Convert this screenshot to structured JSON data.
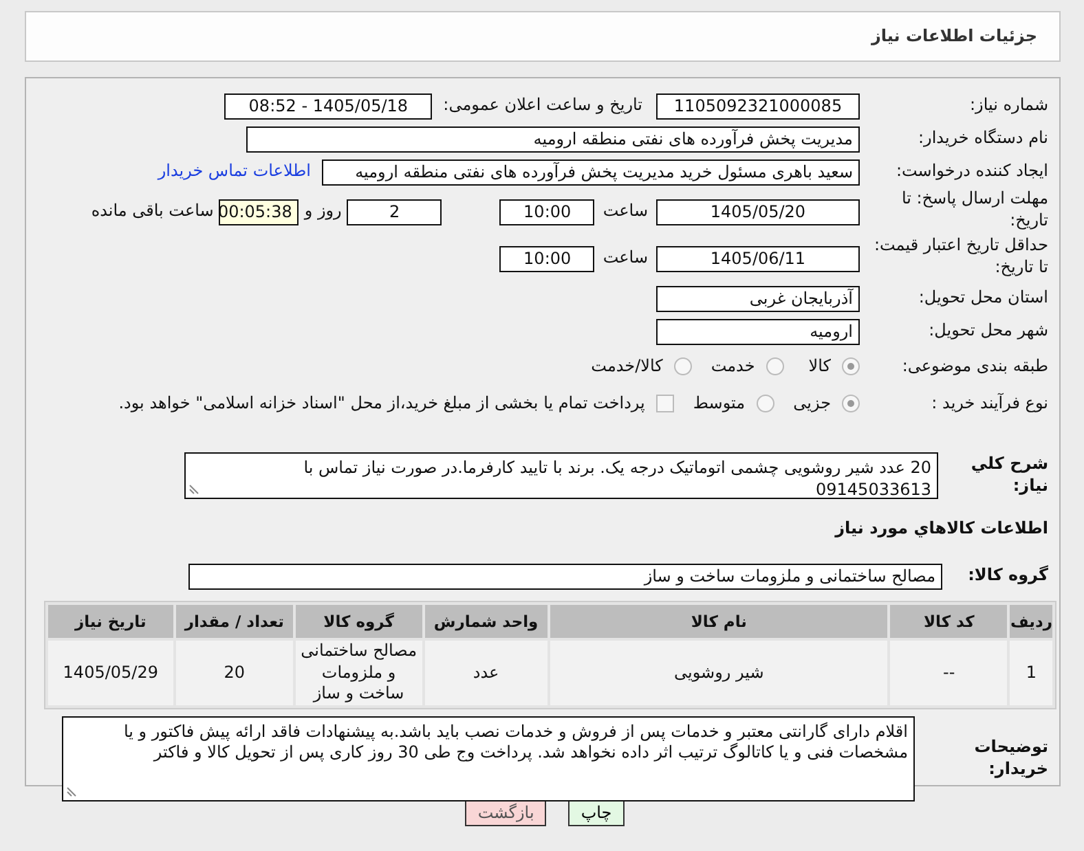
{
  "header": {
    "title": "جزئیات اطلاعات نیاز"
  },
  "need_number": {
    "label": "شماره نیاز:",
    "value": "1105092321000085"
  },
  "announce": {
    "label": "تاریخ و ساعت اعلان عمومی:",
    "value": "1405/05/18 - 08:52"
  },
  "buyer_org": {
    "label": "نام دستگاه خریدار:",
    "value": "مدیریت پخش فرآورده های نفتی منطقه ارومیه"
  },
  "requester": {
    "label": "ایجاد کننده درخواست:",
    "value": "سعید باهری مسئول خرید مدیریت پخش فرآورده های نفتی منطقه ارومیه",
    "link": "اطلاعات تماس خریدار"
  },
  "response_deadline": {
    "label": "مهلت ارسال پاسخ: تا تاریخ:",
    "date": "1405/05/20",
    "time_label": "ساعت",
    "time": "10:00",
    "days": "2",
    "days_label": "روز و",
    "remaining": "00:05:38",
    "remaining_label": "ساعت باقی مانده"
  },
  "price_validity": {
    "label": "حداقل تاریخ اعتبار قیمت: تا تاریخ:",
    "date": "1405/06/11",
    "time_label": "ساعت",
    "time": "10:00"
  },
  "province": {
    "label": "استان محل تحویل:",
    "value": "آذربایجان غربی"
  },
  "city": {
    "label": "شهر محل تحویل:",
    "value": "ارومیه"
  },
  "category": {
    "label": "طبقه بندی موضوعی:",
    "options": [
      {
        "label": "کالا",
        "selected": true
      },
      {
        "label": "خدمت",
        "selected": false
      },
      {
        "label": "کالا/خدمت",
        "selected": false
      }
    ]
  },
  "process": {
    "label": "نوع فرآیند خرید :",
    "options": [
      {
        "label": "جزیی",
        "selected": true
      },
      {
        "label": "متوسط",
        "selected": false
      }
    ],
    "payment": {
      "label": "پرداخت تمام یا بخشی از مبلغ خرید،از محل \"اسناد خزانه اسلامی\" خواهد بود.",
      "checked": false
    }
  },
  "description": {
    "label": "شرح کلي نياز:",
    "value": "20 عدد شیر روشویی چشمی اتوماتیک درجه یک. برند با تایید کارفرما.در صورت نیاز تماس با 09145033613"
  },
  "goods_section": {
    "title": "اطلاعات کالاهاي مورد نياز"
  },
  "goods_group": {
    "label": "گروه کالا:",
    "value": "مصالح ساختمانی و ملزومات ساخت و ساز"
  },
  "table": {
    "columns": [
      "ردیف",
      "کد کالا",
      "نام کالا",
      "واحد شمارش",
      "گروه کالا",
      "تعداد / مقدار",
      "تاریخ نیاز"
    ],
    "rows": [
      [
        "1",
        "--",
        "شیر روشویی",
        "عدد",
        "مصالح ساختمانی و ملزومات ساخت و ساز",
        "20",
        "1405/05/29"
      ]
    ]
  },
  "notes": {
    "label": "توضیحات خریدار:",
    "value": "اقلام دارای گارانتی معتبر و خدمات پس از فروش و خدمات نصب باید باشد.به پیشنهادات فاقد ارائه پیش فاکتور و یا مشخصات فنی و یا کاتالوگ ترتیب اثر داده نخواهد شد. پرداخت وج طی 30 روز کاری پس از تحویل کالا و فاکتر"
  },
  "buttons": [
    {
      "label": "چاپ",
      "kind": "print"
    },
    {
      "label": "بازگشت",
      "kind": "back"
    }
  ]
}
